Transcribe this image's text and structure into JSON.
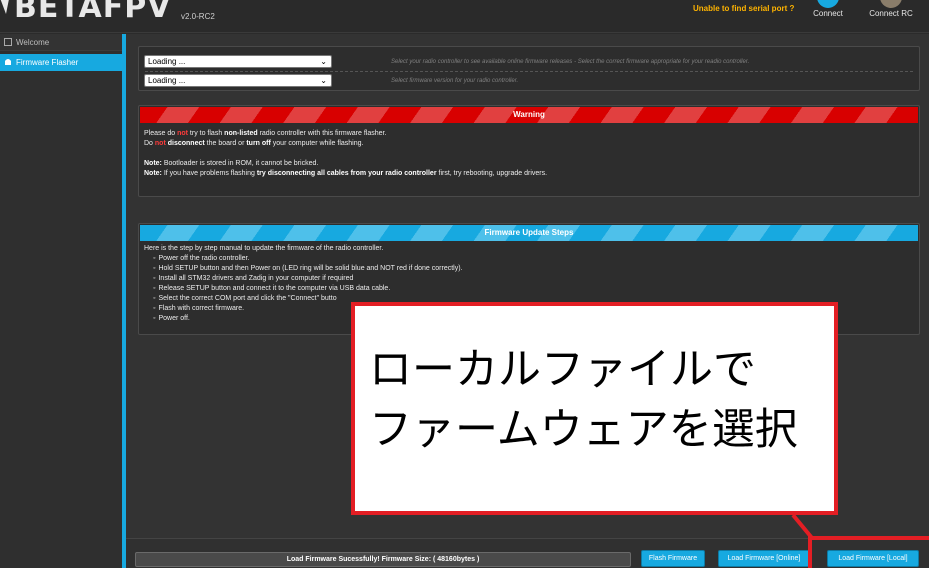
{
  "header": {
    "logo_text": "BETAFPV",
    "version": "v2.0-RC2",
    "serial_message": "Unable to find serial port ?",
    "connect_label": "Connect",
    "connect_rc_label": "Connect RC"
  },
  "sidebar": {
    "items": [
      {
        "label": "Welcome",
        "icon": "home-icon"
      },
      {
        "label": "Firmware Flasher",
        "icon": "android-icon"
      }
    ]
  },
  "controller": {
    "select1_value": "Loading ...",
    "select1_hint": "Select your radio controller to see available online firmware releases - Select the correct firmware appropriate for your readio controller.",
    "select2_value": "Loading ...",
    "select2_hint": "Select firmware version for your radio controller."
  },
  "warning": {
    "title": "Warning",
    "l1_a": "Please do ",
    "l1_not": "not",
    "l1_b": " try to flash ",
    "l1_bold": "non-listed",
    "l1_c": " radio controller with this firmware flasher.",
    "l2_a": "Do ",
    "l2_not": "not",
    "l2_bold1": "disconnect",
    "l2_b": " the board or ",
    "l2_bold2": "turn off",
    "l2_c": " your computer while flashing.",
    "n1_label": "Note:",
    "n1_text": " Bootloader is stored in ROM, it cannot be bricked.",
    "n2_label": "Note:",
    "n2_a": " If you have problems flashing ",
    "n2_bold": "try disconnecting all cables from your radio controller",
    "n2_b": " first, try rebooting, upgrade drivers."
  },
  "steps": {
    "title": "Firmware Update Steps",
    "intro": "Here is the step by step manual to update the firmware of the radio controller.",
    "items": [
      "Power off the radio controller.",
      "Hold SETUP button and then Power on (LED ring will be solid blue and NOT red if done correctly).",
      "Install all STM32 drivers and Zadig in your computer if required",
      "Release SETUP button and connect it to the computer via USB data cable.",
      "Select the correct COM port and click the \"Connect\" butto",
      "Flash with correct firmware.",
      "Power off."
    ]
  },
  "bottom": {
    "status": "Load Firmware Sucessfully! Firmware Size: ( 48160bytes )",
    "flash_label": "Flash Firmware",
    "online_label": "Load Firmware [Online]",
    "local_label": "Load Firmware [Local]"
  },
  "callout": {
    "line1": "ローカルファイルで",
    "line2": "ファームウェアを選択"
  },
  "colors": {
    "accent": "#17a9e0",
    "warning_red": "#d80000",
    "callout_red": "#e31e24",
    "serial_orange": "#ffb400"
  }
}
